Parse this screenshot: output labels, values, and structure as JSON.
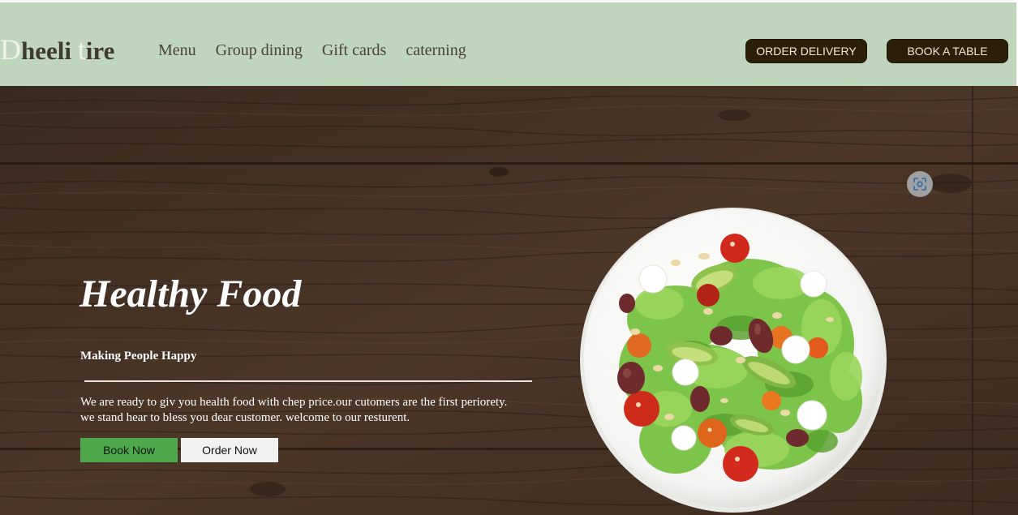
{
  "brand": {
    "first_letter": "D",
    "part1": "heeli ",
    "second_letter": "t",
    "part2": "ire"
  },
  "nav": {
    "items": [
      {
        "label": "Menu"
      },
      {
        "label": "Group dining"
      },
      {
        "label": "Gift cards"
      },
      {
        "label": "caterning"
      }
    ]
  },
  "header_actions": {
    "order_delivery": "ORDER DELIVERY",
    "book_table": "BOOK A TABLE"
  },
  "hero": {
    "title": "Healthy Food",
    "subtitle": "Making People Happy",
    "description_line1": "We are ready to giv you health food with chep price.our cutomers are the first periorety.",
    "description_line2": "we stand hear to bless you dear customer. welcome to our resturent.",
    "book_now": "Book Now",
    "order_now": "Order Now",
    "image_icon": "scan-image-icon"
  },
  "colors": {
    "header_bg": "#bfd6bd",
    "wood_dark": "#3b2a1e",
    "button_dark": "#2c1f09",
    "book_now_green": "#4ca84a",
    "order_now_light": "#f1f1f1"
  }
}
